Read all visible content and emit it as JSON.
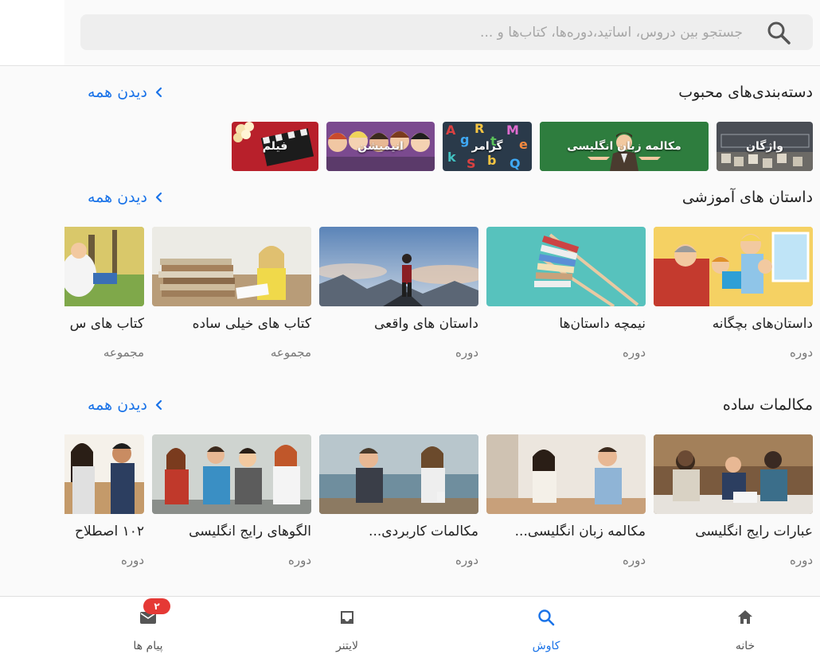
{
  "search": {
    "placeholder": "جستجو بین دروس، اساتید،دوره‌ها، کتاب‌ها و ...",
    "value": ""
  },
  "sections": {
    "categories": {
      "title": "دسته‌بندی‌های محبوب",
      "see_all": "دیدن همه",
      "items": [
        {
          "label": "واژگان"
        },
        {
          "label": "مکالمه زبان انگلیسی"
        },
        {
          "label": "گرامر"
        },
        {
          "label": "انیمیشن"
        },
        {
          "label": "فیلم"
        }
      ]
    },
    "stories": {
      "title": "داستان های آموزشی",
      "see_all": "دیدن همه",
      "cards": [
        {
          "title": "داستان‌های بچگانه",
          "type": "دوره"
        },
        {
          "title": "نیمچه داستان‌ها",
          "type": "دوره"
        },
        {
          "title": "داستان های واقعی",
          "type": "دوره"
        },
        {
          "title": "کتاب های خیلی ساده",
          "type": "مجموعه"
        },
        {
          "title": "کتاب های س",
          "type": "مجموعه"
        }
      ]
    },
    "conversations": {
      "title": "مکالمات ساده",
      "see_all": "دیدن همه",
      "cards": [
        {
          "title": "عبارات رایج انگلیسی",
          "type": "دوره"
        },
        {
          "title": "مکالمه زبان انگلیسی...",
          "type": "دوره"
        },
        {
          "title": "مکالمات کاربردی...",
          "type": "دوره"
        },
        {
          "title": "الگوهای رایج انگلیسی",
          "type": "دوره"
        },
        {
          "title": "۱۰۲ اصطلاح",
          "type": "دوره"
        }
      ]
    }
  },
  "bottom_nav": {
    "items": [
      {
        "label": "خانه",
        "icon": "home-icon"
      },
      {
        "label": "کاوش",
        "icon": "search-icon",
        "active": true
      },
      {
        "label": "لایتنر",
        "icon": "inbox-icon"
      },
      {
        "label": "پیام ها",
        "icon": "mail-icon",
        "badge": "۲"
      }
    ]
  },
  "colors": {
    "accent": "#1a73e8",
    "badge": "#e53935",
    "conversation_chip": "#2e7d3e"
  }
}
